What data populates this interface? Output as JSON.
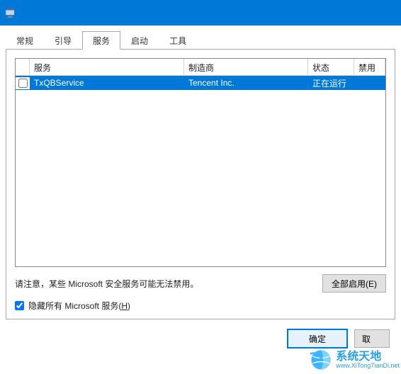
{
  "tabs": [
    {
      "label": "常规"
    },
    {
      "label": "引导"
    },
    {
      "label": "服务"
    },
    {
      "label": "启动"
    },
    {
      "label": "工具"
    }
  ],
  "columns": {
    "service": "服务",
    "manufacturer": "制造商",
    "status": "状态",
    "disabled_date": "禁用日"
  },
  "rows": [
    {
      "service": "TxQBService",
      "manufacturer": "Tencent Inc.",
      "status": "正在运行",
      "disabled_date": "",
      "checked": false,
      "selected": true
    }
  ],
  "notice": "请注意，某些 Microsoft 安全服务可能无法禁用。",
  "buttons": {
    "enable_all": "全部启用(E)",
    "ok": "确定",
    "cancel": "取"
  },
  "hide_ms": {
    "label": "隐藏所有 Microsoft 服务(H)",
    "label_prefix": "隐藏所有 Microsoft 服务(",
    "label_key": "H",
    "label_suffix": ")",
    "checked": true
  },
  "watermark": {
    "zh": "系统天地",
    "en": "www.XiTongTianDi.net"
  }
}
